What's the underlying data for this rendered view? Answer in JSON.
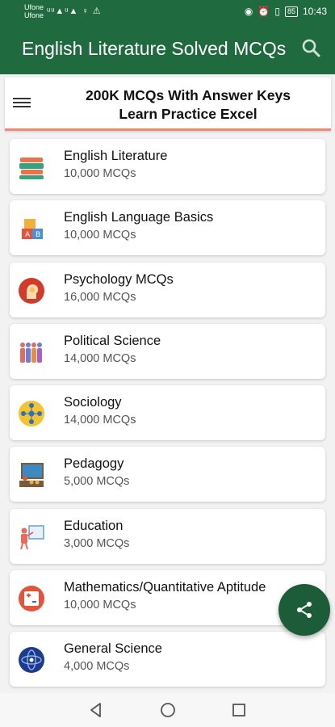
{
  "status_bar": {
    "carrier_1": "Ufone",
    "carrier_2": "Ufone",
    "signal_text": "ᵘᵘ▲ᵘ▲ ♀ ⚠",
    "battery": "85",
    "time": "10:43"
  },
  "app_bar": {
    "title": "English Literature Solved MCQs",
    "search_icon": "search-icon"
  },
  "banner": {
    "line1": "200K MCQs With Answer Keys",
    "line2": "Learn Practice Excel"
  },
  "categories": [
    {
      "title": "English Literature",
      "count": "10,000 MCQs",
      "icon": "books-icon"
    },
    {
      "title": "English Language Basics",
      "count": "10,000 MCQs",
      "icon": "alphabet-blocks-icon"
    },
    {
      "title": "Psychology MCQs",
      "count": "16,000 MCQs",
      "icon": "head-lightbulb-icon"
    },
    {
      "title": "Political Science",
      "count": "14,000 MCQs",
      "icon": "people-group-icon"
    },
    {
      "title": "Sociology",
      "count": "14,000 MCQs",
      "icon": "social-network-icon"
    },
    {
      "title": "Pedagogy",
      "count": "5,000 MCQs",
      "icon": "classroom-icon"
    },
    {
      "title": "Education",
      "count": "3,000 MCQs",
      "icon": "teacher-board-icon"
    },
    {
      "title": "Mathematics/Quantitative Aptitude",
      "count": "10,000 MCQs",
      "icon": "math-icon"
    },
    {
      "title": "General Science",
      "count": "4,000 MCQs",
      "icon": "science-globe-icon"
    }
  ],
  "fab": {
    "icon": "share-icon"
  },
  "colors": {
    "primary": "#1f6a3f",
    "banner_underline": "#f08a6a",
    "fab": "#1d5c38"
  }
}
